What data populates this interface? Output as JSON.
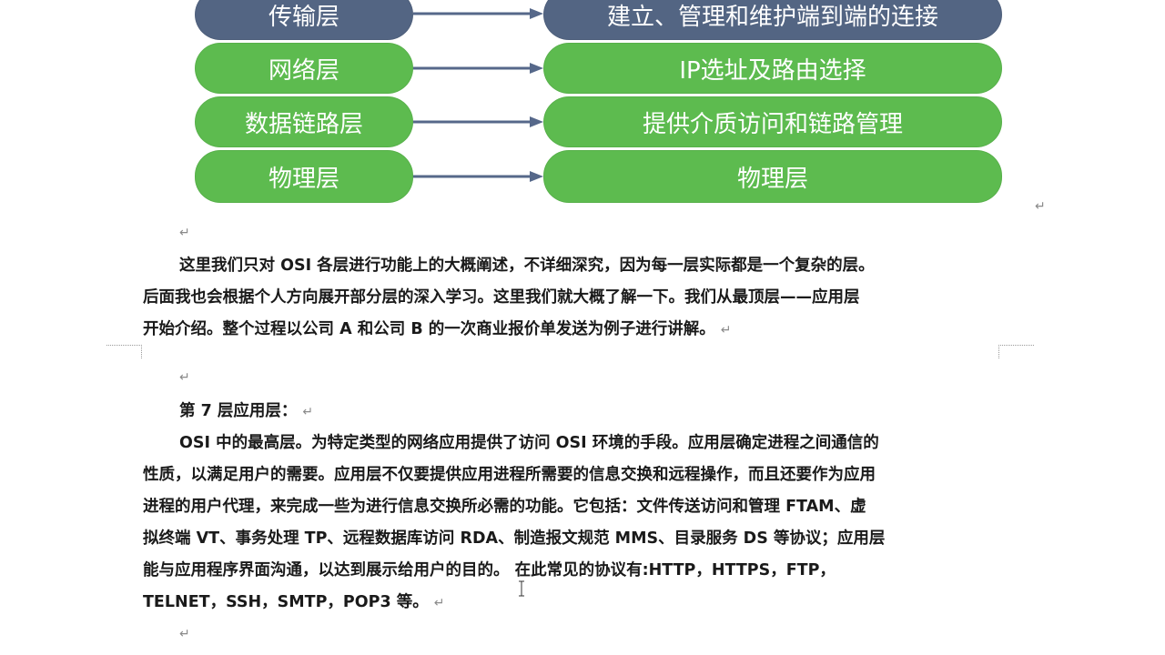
{
  "diagram": {
    "rows": [
      {
        "layer": "传输层",
        "function": "建立、管理和维护端到端的连接"
      },
      {
        "layer": "网络层",
        "function": "IP选址及路由选择"
      },
      {
        "layer": "数据链路层",
        "function": "提供介质访问和链路管理"
      },
      {
        "layer": "物理层",
        "function": "物理层"
      }
    ],
    "colors": {
      "transport": "#536583",
      "green": "#5dbb4f",
      "arrow": "#56688a"
    }
  },
  "marks": {
    "return": "↵"
  },
  "intro": {
    "lines": [
      "这里我们只对 OSI 各层进行功能上的大概阐述，不详细深究，因为每一层实际都是一个复杂的层。",
      "后面我也会根据个人方向展开部分层的深入学习。这里我们就大概了解一下。我们从最顶层——应用层",
      "开始介绍。整个过程以公司 A 和公司 B 的一次商业报价单发送为例子进行讲解。"
    ]
  },
  "section": {
    "heading": "第 7 层应用层：",
    "lines": [
      "OSI 中的最高层。为特定类型的网络应用提供了访问 OSI 环境的手段。应用层确定进程之间通信的",
      "性质，以满足用户的需要。应用层不仅要提供应用进程所需要的信息交换和远程操作，而且还要作为应用",
      "进程的用户代理，来完成一些为进行信息交换所必需的功能。它包括：文件传送访问和管理 FTAM、虚",
      "拟终端 VT、事务处理 TP、远程数据库访问 RDA、制造报文规范 MMS、目录服务 DS 等协议；应用层",
      "能与应用程序界面沟通，以达到展示给用户的目的。  在此常见的协议有:HTTP，HTTPS，FTP，",
      "TELNET，SSH，SMTP，POP3 等。"
    ]
  }
}
